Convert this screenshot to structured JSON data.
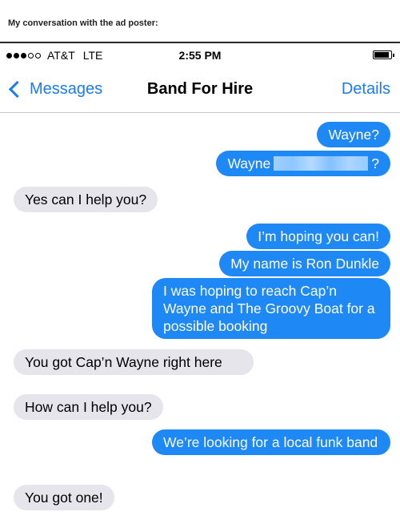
{
  "caption": "My conversation with the ad poster:",
  "status_bar": {
    "carrier": "AT&T",
    "network": "LTE",
    "time": "2:55 PM",
    "signal_bars": 3,
    "signal_total": 5
  },
  "nav": {
    "back_label": "Messages",
    "title": "Band For Hire",
    "details_label": "Details"
  },
  "colors": {
    "outgoing": "#1e88f5",
    "incoming": "#e6e5eb",
    "accent": "#1a7cf0"
  },
  "messages": [
    {
      "direction": "outgoing",
      "text": "Wayne?"
    },
    {
      "direction": "outgoing",
      "text_before": "Wayne",
      "text_after": "?",
      "redacted": true
    },
    {
      "direction": "incoming",
      "text": "Yes can I help you?"
    },
    {
      "direction": "outgoing",
      "text": "I’m hoping you can!"
    },
    {
      "direction": "outgoing",
      "text": "My name is Ron Dunkle"
    },
    {
      "direction": "outgoing",
      "text": "I was hoping to reach Cap’n Wayne and The Groovy Boat for a possible booking"
    },
    {
      "direction": "incoming",
      "text": "You got Cap’n Wayne right here"
    },
    {
      "direction": "incoming",
      "text": "How can I help you?"
    },
    {
      "direction": "outgoing",
      "text": "We’re looking for a local funk band"
    },
    {
      "direction": "incoming",
      "text": "You got one!"
    }
  ]
}
